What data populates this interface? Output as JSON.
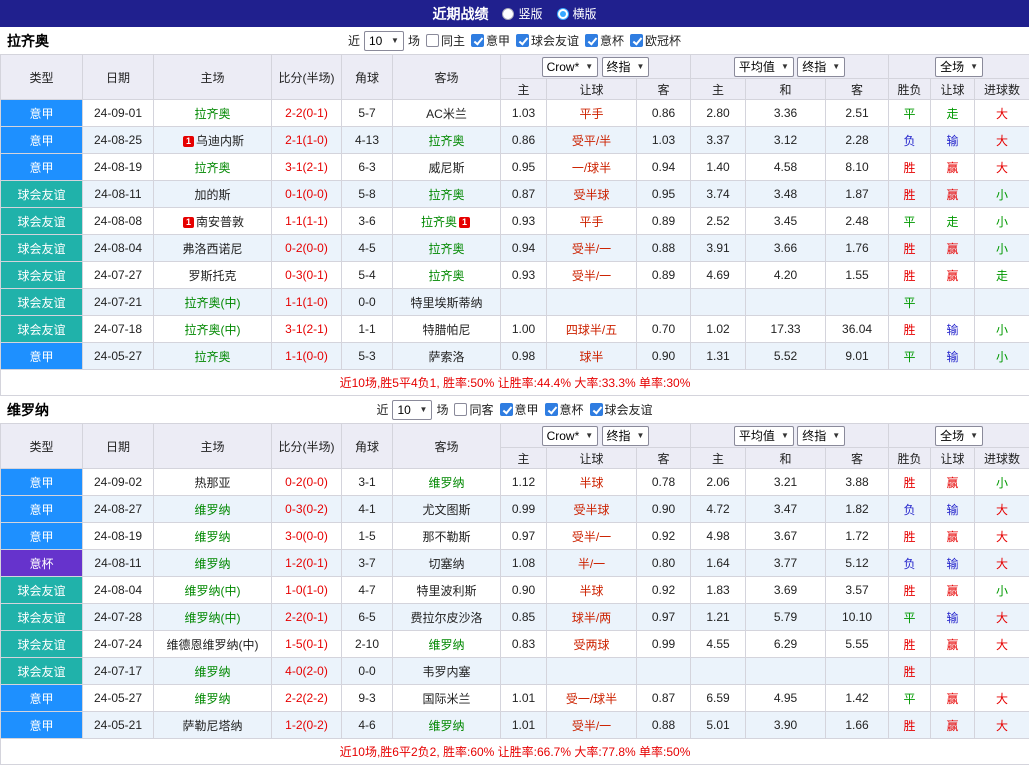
{
  "topbar": {
    "title": "近期战绩",
    "view_options": [
      {
        "label": "竖版",
        "selected": false
      },
      {
        "label": "横版",
        "selected": true
      }
    ]
  },
  "icons": {
    "dropdown_arrow": "▼",
    "rank_badge": "1"
  },
  "colors": {
    "topbar_bg": "#20208e",
    "serie_a_bg": "#1e90ff",
    "friendly_bg": "#20b2aa",
    "italy_cup_bg": "#6633cc",
    "win_red": "#e60000",
    "draw_green": "#009900",
    "loss_blue": "#2424cc",
    "team_green": "#008800",
    "header_bg": "#ececf5",
    "alt_row_bg": "#ebf3fb"
  },
  "sections": [
    {
      "team_title": "拉齐奥",
      "filter": {
        "near": "近",
        "count": "10",
        "unit": "场",
        "same": {
          "label": "同主",
          "checked": false
        },
        "leagues": [
          {
            "label": "意甲",
            "checked": true
          },
          {
            "label": "球会友谊",
            "checked": true
          },
          {
            "label": "意杯",
            "checked": true
          },
          {
            "label": "欧冠杯",
            "checked": true
          }
        ]
      },
      "table": {
        "headers": {
          "type": "类型",
          "date": "日期",
          "home": "主场",
          "score": "比分(半场)",
          "corner": "角球",
          "away": "客场",
          "odds_select": "Crow*",
          "odds_select2": "终指",
          "odds_cols": [
            "主",
            "让球",
            "客"
          ],
          "avg_select": "平均值",
          "avg_select2": "终指",
          "avg_cols": [
            "主",
            "和",
            "客"
          ],
          "full_select": "全场",
          "full_cols": [
            "胜负",
            "让球",
            "进球数"
          ]
        },
        "rows": [
          {
            "league": "意甲",
            "date": "24-09-01",
            "home": "拉齐奥",
            "home_green": true,
            "score": "2-2(0-1)",
            "corner": "5-7",
            "away": "AC米兰",
            "odds_home": "1.03",
            "handicap": "平手",
            "odds_away": "0.86",
            "avg_home": "2.80",
            "avg_draw": "3.36",
            "avg_away": "2.51",
            "result": "平",
            "result_color": "green",
            "cover": "走",
            "cover_color": "green",
            "total": "大",
            "total_color": "red"
          },
          {
            "league": "意甲",
            "date": "24-08-25",
            "home": "乌迪内斯",
            "home_badge": true,
            "score": "2-1(1-0)",
            "corner": "4-13",
            "away": "拉齐奥",
            "away_green": true,
            "odds_home": "0.86",
            "handicap": "受平/半",
            "odds_away": "1.03",
            "avg_home": "3.37",
            "avg_draw": "3.12",
            "avg_away": "2.28",
            "result": "负",
            "result_color": "blue",
            "cover": "输",
            "cover_color": "blue",
            "total": "大",
            "total_color": "red"
          },
          {
            "league": "意甲",
            "date": "24-08-19",
            "home": "拉齐奥",
            "home_green": true,
            "score": "3-1(2-1)",
            "corner": "6-3",
            "away": "威尼斯",
            "odds_home": "0.95",
            "handicap": "一/球半",
            "odds_away": "0.94",
            "avg_home": "1.40",
            "avg_draw": "4.58",
            "avg_away": "8.10",
            "result": "胜",
            "result_color": "red",
            "cover": "赢",
            "cover_color": "red",
            "total": "大",
            "total_color": "red"
          },
          {
            "league": "球会友谊",
            "date": "24-08-11",
            "home": "加的斯",
            "score": "0-1(0-0)",
            "corner": "5-8",
            "away": "拉齐奥",
            "away_green": true,
            "odds_home": "0.87",
            "handicap": "受半球",
            "odds_away": "0.95",
            "avg_home": "3.74",
            "avg_draw": "3.48",
            "avg_away": "1.87",
            "result": "胜",
            "result_color": "red",
            "cover": "赢",
            "cover_color": "red",
            "total": "小",
            "total_color": "green"
          },
          {
            "league": "球会友谊",
            "date": "24-08-08",
            "home": "南安普敦",
            "home_badge": true,
            "score": "1-1(1-1)",
            "corner": "3-6",
            "away": "拉齐奥",
            "away_green": true,
            "away_badge": true,
            "odds_home": "0.93",
            "handicap": "平手",
            "odds_away": "0.89",
            "avg_home": "2.52",
            "avg_draw": "3.45",
            "avg_away": "2.48",
            "result": "平",
            "result_color": "green",
            "cover": "走",
            "cover_color": "green",
            "total": "小",
            "total_color": "green"
          },
          {
            "league": "球会友谊",
            "date": "24-08-04",
            "home": "弗洛西诺尼",
            "score": "0-2(0-0)",
            "corner": "4-5",
            "away": "拉齐奥",
            "away_green": true,
            "odds_home": "0.94",
            "handicap": "受半/一",
            "odds_away": "0.88",
            "avg_home": "3.91",
            "avg_draw": "3.66",
            "avg_away": "1.76",
            "result": "胜",
            "result_color": "red",
            "cover": "赢",
            "cover_color": "red",
            "total": "小",
            "total_color": "green"
          },
          {
            "league": "球会友谊",
            "date": "24-07-27",
            "home": "罗斯托克",
            "score": "0-3(0-1)",
            "corner": "5-4",
            "away": "拉齐奥",
            "away_green": true,
            "odds_home": "0.93",
            "handicap": "受半/一",
            "odds_away": "0.89",
            "avg_home": "4.69",
            "avg_draw": "4.20",
            "avg_away": "1.55",
            "result": "胜",
            "result_color": "red",
            "cover": "赢",
            "cover_color": "red",
            "total": "走",
            "total_color": "green"
          },
          {
            "league": "球会友谊",
            "date": "24-07-21",
            "home": "拉齐奥(中)",
            "home_green": true,
            "score": "1-1(1-0)",
            "corner": "0-0",
            "away": "特里埃斯蒂纳",
            "odds_home": "",
            "handicap": "",
            "odds_away": "",
            "avg_home": "",
            "avg_draw": "",
            "avg_away": "",
            "result": "平",
            "result_color": "green",
            "cover": "",
            "total": ""
          },
          {
            "league": "球会友谊",
            "date": "24-07-18",
            "home": "拉齐奥(中)",
            "home_green": true,
            "score": "3-1(2-1)",
            "corner": "1-1",
            "away": "特腊帕尼",
            "odds_home": "1.00",
            "handicap": "四球半/五",
            "odds_away": "0.70",
            "avg_home": "1.02",
            "avg_draw": "17.33",
            "avg_away": "36.04",
            "result": "胜",
            "result_color": "red",
            "cover": "输",
            "cover_color": "blue",
            "total": "小",
            "total_color": "green"
          },
          {
            "league": "意甲",
            "date": "24-05-27",
            "home": "拉齐奥",
            "home_green": true,
            "score": "1-1(0-0)",
            "corner": "5-3",
            "away": "萨索洛",
            "odds_home": "0.98",
            "handicap": "球半",
            "odds_away": "0.90",
            "avg_home": "1.31",
            "avg_draw": "5.52",
            "avg_away": "9.01",
            "result": "平",
            "result_color": "green",
            "cover": "输",
            "cover_color": "blue",
            "total": "小",
            "total_color": "green"
          }
        ]
      },
      "summary": "近10场,胜5平4负1, 胜率:50% 让胜率:44.4% 大率:33.3% 单率:30%"
    },
    {
      "team_title": "维罗纳",
      "filter": {
        "near": "近",
        "count": "10",
        "unit": "场",
        "same": {
          "label": "同客",
          "checked": false
        },
        "leagues": [
          {
            "label": "意甲",
            "checked": true
          },
          {
            "label": "意杯",
            "checked": true
          },
          {
            "label": "球会友谊",
            "checked": true
          }
        ]
      },
      "table": {
        "headers": {
          "type": "类型",
          "date": "日期",
          "home": "主场",
          "score": "比分(半场)",
          "corner": "角球",
          "away": "客场",
          "odds_select": "Crow*",
          "odds_select2": "终指",
          "odds_cols": [
            "主",
            "让球",
            "客"
          ],
          "avg_select": "平均值",
          "avg_select2": "终指",
          "avg_cols": [
            "主",
            "和",
            "客"
          ],
          "full_select": "全场",
          "full_cols": [
            "胜负",
            "让球",
            "进球数"
          ]
        },
        "rows": [
          {
            "league": "意甲",
            "date": "24-09-02",
            "home": "热那亚",
            "score": "0-2(0-0)",
            "corner": "3-1",
            "away": "维罗纳",
            "away_green": true,
            "odds_home": "1.12",
            "handicap": "半球",
            "odds_away": "0.78",
            "avg_home": "2.06",
            "avg_draw": "3.21",
            "avg_away": "3.88",
            "result": "胜",
            "result_color": "red",
            "cover": "赢",
            "cover_color": "red",
            "total": "小",
            "total_color": "green"
          },
          {
            "league": "意甲",
            "date": "24-08-27",
            "home": "维罗纳",
            "home_green": true,
            "score": "0-3(0-2)",
            "corner": "4-1",
            "away": "尤文图斯",
            "odds_home": "0.99",
            "handicap": "受半球",
            "odds_away": "0.90",
            "avg_home": "4.72",
            "avg_draw": "3.47",
            "avg_away": "1.82",
            "result": "负",
            "result_color": "blue",
            "cover": "输",
            "cover_color": "blue",
            "total": "大",
            "total_color": "red"
          },
          {
            "league": "意甲",
            "date": "24-08-19",
            "home": "维罗纳",
            "home_green": true,
            "score": "3-0(0-0)",
            "corner": "1-5",
            "away": "那不勒斯",
            "odds_home": "0.97",
            "handicap": "受半/一",
            "odds_away": "0.92",
            "avg_home": "4.98",
            "avg_draw": "3.67",
            "avg_away": "1.72",
            "result": "胜",
            "result_color": "red",
            "cover": "赢",
            "cover_color": "red",
            "total": "大",
            "total_color": "red"
          },
          {
            "league": "意杯",
            "date": "24-08-11",
            "home": "维罗纳",
            "home_green": true,
            "score": "1-2(0-1)",
            "corner": "3-7",
            "away": "切塞纳",
            "odds_home": "1.08",
            "handicap": "半/一",
            "odds_away": "0.80",
            "avg_home": "1.64",
            "avg_draw": "3.77",
            "avg_away": "5.12",
            "result": "负",
            "result_color": "blue",
            "cover": "输",
            "cover_color": "blue",
            "total": "大",
            "total_color": "red"
          },
          {
            "league": "球会友谊",
            "date": "24-08-04",
            "home": "维罗纳(中)",
            "home_green": true,
            "score": "1-0(1-0)",
            "corner": "4-7",
            "away": "特里波利斯",
            "odds_home": "0.90",
            "handicap": "半球",
            "odds_away": "0.92",
            "avg_home": "1.83",
            "avg_draw": "3.69",
            "avg_away": "3.57",
            "result": "胜",
            "result_color": "red",
            "cover": "赢",
            "cover_color": "red",
            "total": "小",
            "total_color": "green"
          },
          {
            "league": "球会友谊",
            "date": "24-07-28",
            "home": "维罗纳(中)",
            "home_green": true,
            "score": "2-2(0-1)",
            "corner": "6-5",
            "away": "费拉尔皮沙洛",
            "odds_home": "0.85",
            "handicap": "球半/两",
            "odds_away": "0.97",
            "avg_home": "1.21",
            "avg_draw": "5.79",
            "avg_away": "10.10",
            "result": "平",
            "result_color": "green",
            "cover": "输",
            "cover_color": "blue",
            "total": "大",
            "total_color": "red"
          },
          {
            "league": "球会友谊",
            "date": "24-07-24",
            "home": "维德恩维罗纳(中)",
            "score": "1-5(0-1)",
            "corner": "2-10",
            "away": "维罗纳",
            "away_green": true,
            "odds_home": "0.83",
            "handicap": "受两球",
            "odds_away": "0.99",
            "avg_home": "4.55",
            "avg_draw": "6.29",
            "avg_away": "5.55",
            "result": "胜",
            "result_color": "red",
            "cover": "赢",
            "cover_color": "red",
            "total": "大",
            "total_color": "red"
          },
          {
            "league": "球会友谊",
            "date": "24-07-17",
            "home": "维罗纳",
            "home_green": true,
            "score": "4-0(2-0)",
            "corner": "0-0",
            "away": "韦罗内塞",
            "odds_home": "",
            "handicap": "",
            "odds_away": "",
            "avg_home": "",
            "avg_draw": "",
            "avg_away": "",
            "result": "胜",
            "result_color": "red",
            "cover": "",
            "total": ""
          },
          {
            "league": "意甲",
            "date": "24-05-27",
            "home": "维罗纳",
            "home_green": true,
            "score": "2-2(2-2)",
            "corner": "9-3",
            "away": "国际米兰",
            "odds_home": "1.01",
            "handicap": "受一/球半",
            "odds_away": "0.87",
            "avg_home": "6.59",
            "avg_draw": "4.95",
            "avg_away": "1.42",
            "result": "平",
            "result_color": "green",
            "cover": "赢",
            "cover_color": "red",
            "total": "大",
            "total_color": "red"
          },
          {
            "league": "意甲",
            "date": "24-05-21",
            "home": "萨勒尼塔纳",
            "score": "1-2(0-2)",
            "corner": "4-6",
            "away": "维罗纳",
            "away_green": true,
            "odds_home": "1.01",
            "handicap": "受半/一",
            "odds_away": "0.88",
            "avg_home": "5.01",
            "avg_draw": "3.90",
            "avg_away": "1.66",
            "result": "胜",
            "result_color": "red",
            "cover": "赢",
            "cover_color": "red",
            "total": "大",
            "total_color": "red"
          }
        ]
      },
      "summary": "近10场,胜6平2负2, 胜率:60% 让胜率:66.7% 大率:77.8% 单率:50%"
    }
  ]
}
